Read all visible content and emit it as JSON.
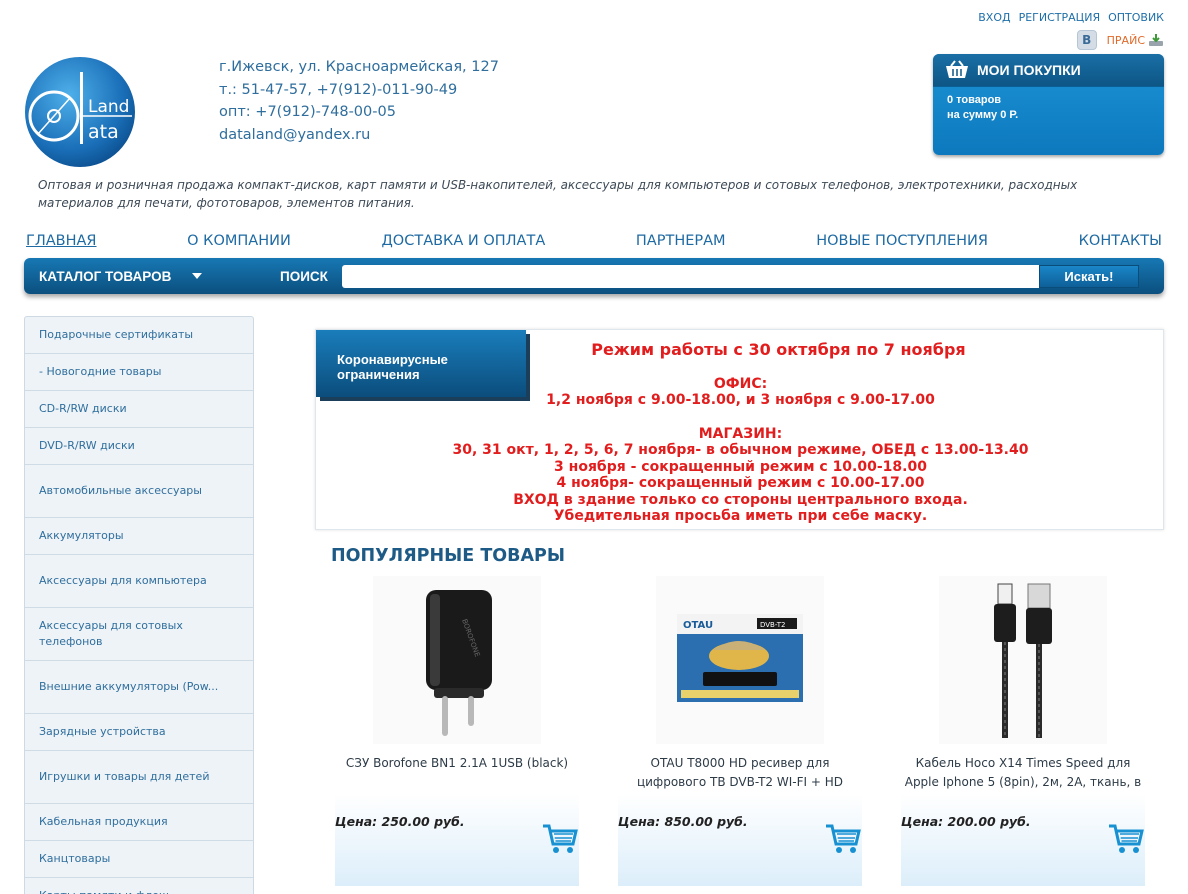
{
  "top_links": {
    "login": "ВХОД",
    "register": "РЕГИСТРАЦИЯ",
    "wholesale": "ОПТОВИК",
    "vk": "В",
    "price": "ПРАЙС"
  },
  "logo": {
    "text_top": "Land",
    "text_bottom": "ata",
    "letter": "D"
  },
  "contacts": {
    "address": "г.Ижевск, ул. Красноармейская, 127",
    "phone": "т.: 51-47-57, +7(912)-011-90-49",
    "wholesale_phone": "опт: +7(912)-748-00-05",
    "email": "dataland@yandex.ru"
  },
  "cart": {
    "title": "МОИ ПОКУПКИ",
    "items": "0 товаров",
    "sum": "на сумму 0 Р."
  },
  "tagline": "Оптовая и розничная продажа компакт-дисков, карт памяти и USB-накопителей, аксессуары для компьютеров и сотовых телефонов, электротехники, расходных материалов для печати, фототоваров, элементов питания.",
  "nav": [
    "ГЛАВНАЯ",
    "О КОМПАНИИ",
    "ДОСТАВКА И ОПЛАТА",
    "ПАРТНЕРАМ",
    "НОВЫЕ ПОСТУПЛЕНИЯ",
    "КОНТАКТЫ"
  ],
  "search": {
    "catalog": "КАТАЛОГ ТОВАРОВ",
    "label": "ПОИСК",
    "value": "",
    "button": "Искать!"
  },
  "sidebar": [
    "Подарочные сертификаты",
    "- Новогодние товары",
    "CD-R/RW диски",
    "DVD-R/RW диски",
    "Автомобильные аксессуары",
    "Аккумуляторы",
    "Аксессуары для компьютера",
    "Аксессуары для сотовых телефонов",
    "Внешние аккумуляторы (Pow...",
    "Зарядные устройства",
    "Игрушки и товары для детей",
    "Кабельная продукция",
    "Канцтовары",
    "Карты памяти и флеш..."
  ],
  "notice": {
    "tab": "Коронавирусные ограничения",
    "title": "Режим работы с 30 октября по 7 ноября",
    "office_head": "ОФИС:",
    "office_hours": "1,2 ноября с 9.00-18.00, и 3 ноября с 9.00-17.00",
    "shop_head": "МАГАЗИН:",
    "shop_line1": "30, 31 окт, 1, 2, 5, 6, 7 ноября- в обычном режиме, ОБЕД с 13.00-13.40",
    "shop_line2": "3 ноября - сокращенный режим с 10.00-18.00",
    "shop_line3": "4 ноября- сокращенный режим с 10.00-17.00",
    "shop_line4": "ВХОД в здание только со стороны центрального входа.",
    "shop_line5": "Убедительная просьба иметь при себе маску."
  },
  "popular": {
    "title": "ПОПУЛЯРНЫЕ ТОВАРЫ",
    "products": [
      {
        "name": "СЗУ Borofone BN1 2.1A 1USB (black)",
        "price": "Цена: 250.00 руб.",
        "image": "charger"
      },
      {
        "name": "OTAU T8000 HD ресивер для цифрового ТВ DVB-T2 WI-FI + HD",
        "price": "Цена: 850.00 руб.",
        "image": "receiver"
      },
      {
        "name": "Кабель Hoco X14 Times Speed для Apple Iphone 5 (8pin), 2м, 2А, ткань, в",
        "price": "Цена: 200.00 руб.",
        "image": "cable"
      }
    ]
  },
  "colors": {
    "brand_blue": "#1f6fa8",
    "notice_red": "#e21d1d",
    "cart_blue": "#1c93d6"
  }
}
